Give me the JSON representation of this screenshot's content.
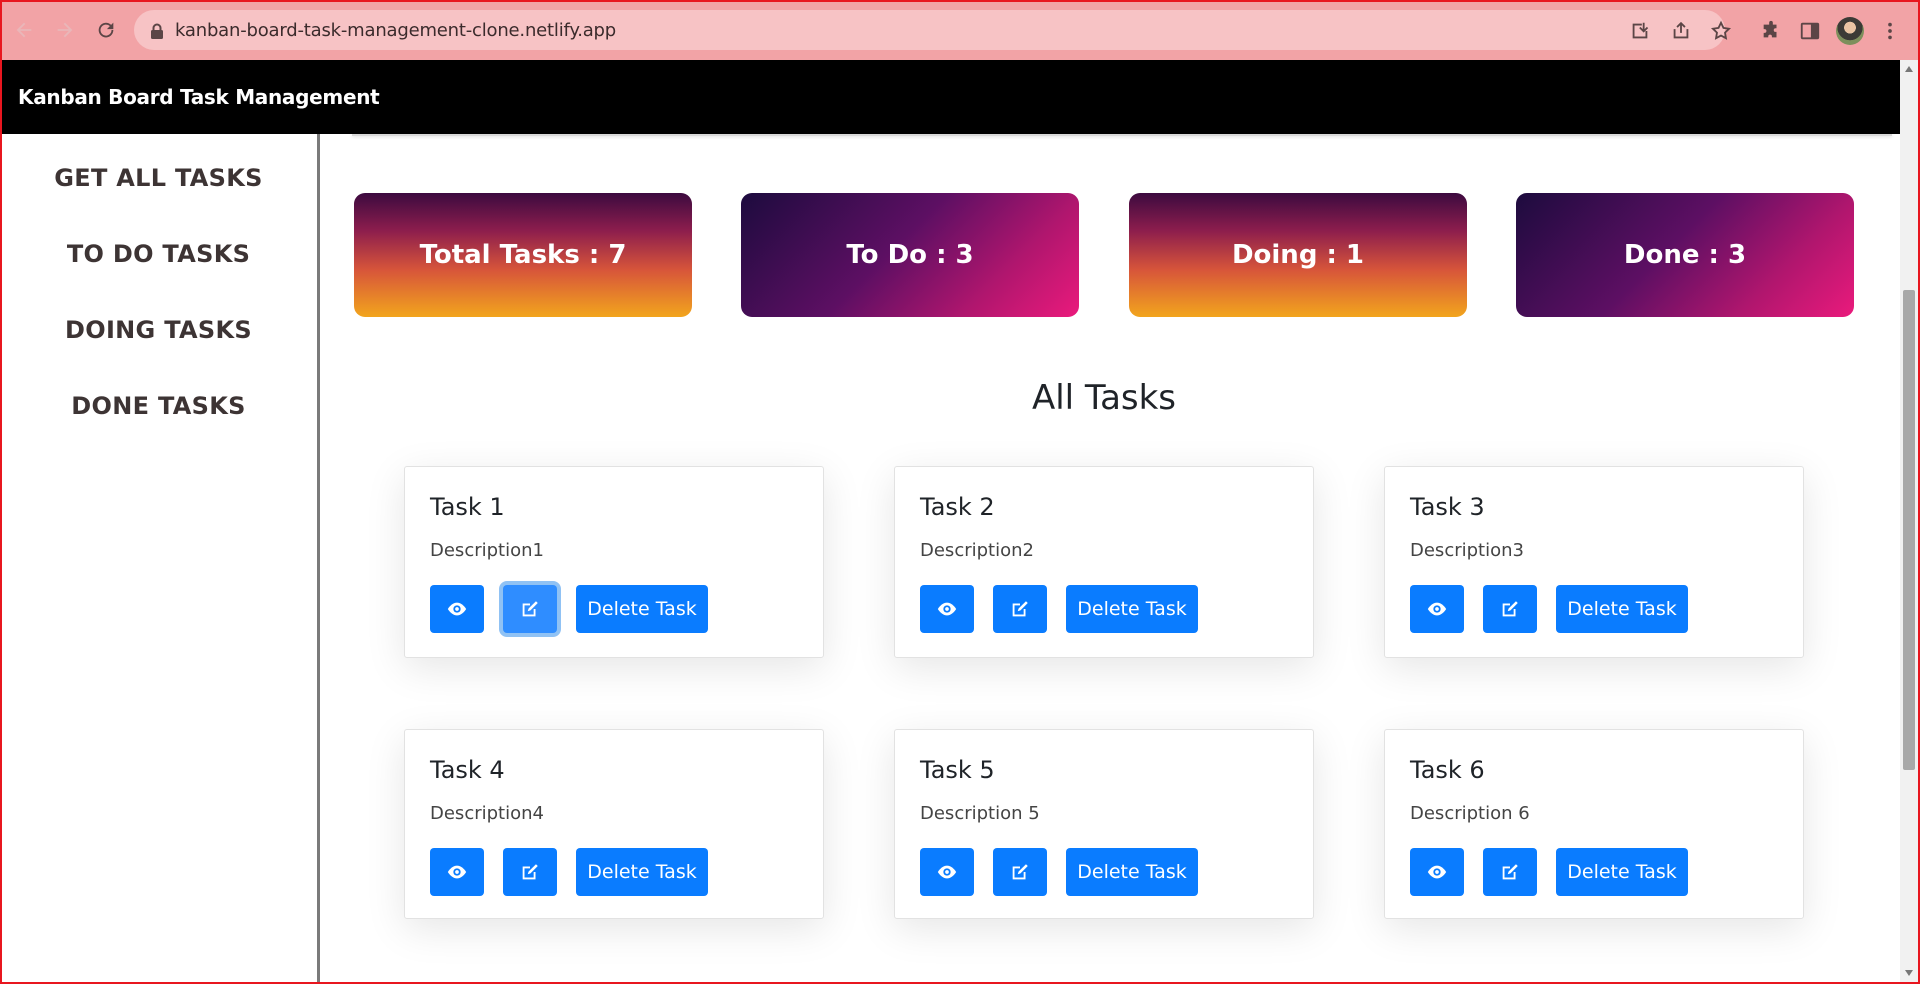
{
  "browser": {
    "url": "kanban-board-task-management-clone.netlify.app"
  },
  "header": {
    "brand": "Kanban Board Task Management"
  },
  "sidebar": {
    "items": [
      {
        "label": "GET ALL TASKS"
      },
      {
        "label": "TO DO TASKS"
      },
      {
        "label": "DOING TASKS"
      },
      {
        "label": "DONE TASKS"
      }
    ]
  },
  "stats": [
    {
      "label": "Total Tasks : 7"
    },
    {
      "label": "To Do : 3"
    },
    {
      "label": "Doing : 1"
    },
    {
      "label": "Done : 3"
    }
  ],
  "main": {
    "section_title": "All Tasks"
  },
  "tasks": [
    {
      "title": "Task 1",
      "description": "Description1",
      "delete_label": "Delete Task"
    },
    {
      "title": "Task 2",
      "description": "Description2",
      "delete_label": "Delete Task"
    },
    {
      "title": "Task 3",
      "description": "Description3",
      "delete_label": "Delete Task"
    },
    {
      "title": "Task 4",
      "description": "Description4",
      "delete_label": "Delete Task"
    },
    {
      "title": "Task 5",
      "description": "Description 5",
      "delete_label": "Delete Task"
    },
    {
      "title": "Task 6",
      "description": "Description 6",
      "delete_label": "Delete Task"
    }
  ],
  "icons": {
    "view": "eye-icon",
    "edit": "edit-icon"
  },
  "colors": {
    "primary_button": "#0a7cff",
    "header_bg": "#000000",
    "browser_chrome": "#f2a3a6"
  }
}
